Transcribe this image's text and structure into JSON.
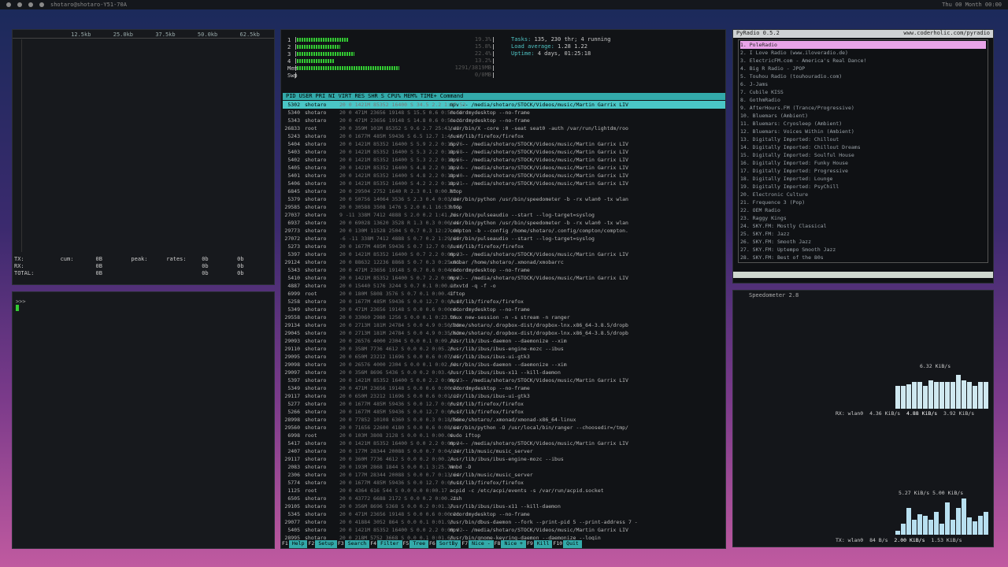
{
  "topbar": {
    "title": "shotaro@shotaro-Y51-70A",
    "tray": "Thu 00 Month 00:00"
  },
  "nload": {
    "scale": [
      "12.5kb",
      "25.0kb",
      "37.5kb",
      "50.0kb",
      "62.5kb"
    ],
    "stats_rows": [
      {
        "label": "TX:",
        "cols": [
          "cum:",
          "0B",
          "peak:",
          "rates:",
          "0b",
          "0b",
          "0b"
        ]
      },
      {
        "label": "RX:",
        "cols": [
          "",
          "0B",
          "",
          "",
          "0b",
          "0b",
          "0b"
        ]
      },
      {
        "label": "TOTAL:",
        "cols": [
          "",
          "0B",
          "",
          "",
          "0b",
          "0b",
          "0b"
        ]
      }
    ]
  },
  "term": {
    "prompt": ">>>"
  },
  "htop": {
    "cpus": [
      {
        "label": "1",
        "fill": 0.26,
        "pct": "19.3%"
      },
      {
        "label": "2",
        "fill": 0.22,
        "pct": "15.8%"
      },
      {
        "label": "3",
        "fill": 0.29,
        "pct": "22.4%"
      },
      {
        "label": "4",
        "fill": 0.19,
        "pct": "13.2%"
      },
      {
        "label": "Mem",
        "fill": 0.52,
        "pct": "1291/3819MB"
      },
      {
        "label": "Swp",
        "fill": 0.0,
        "pct": "0/0MB"
      }
    ],
    "info": [
      {
        "k": "Tasks:",
        "v": "135, 230 thr; 4 running"
      },
      {
        "k": "Load average:",
        "v": "1.28 1.22"
      },
      {
        "k": "Uptime:",
        "v": "4 days, 01:25:18"
      }
    ],
    "header": [
      "PID",
      "USER",
      "PRI",
      "NI",
      "VIRT",
      "RES",
      "SHR",
      "S",
      "CPU%",
      "MEM%",
      "TIME+",
      "Command"
    ],
    "rows": [
      {
        "pid": "5302",
        "user": "shotaro",
        "nums": "20 0 1421M 85352 16400 S 34.5 2.2 1:27.52",
        "cmd": "mpv -- /media/shotaro/STOCK/Videos/music/Martin Garrix LIV"
      },
      {
        "pid": "5340",
        "user": "shotaro",
        "nums": "20 0 471M 23656 19148 S 15.5 0.6 0:58.58",
        "cmd": "recordmydesktop --no-frame"
      },
      {
        "pid": "5343",
        "user": "shotaro",
        "nums": "20 0 471M 23656 19148 S 14.8 0.6 0:51.21",
        "cmd": "recordmydesktop --no-frame"
      },
      {
        "pid": "26833",
        "user": "root",
        "nums": "20 0 359M 101M 85352 S 9.6 2.7 25:43.43",
        "cmd": "/usr/bin/X -core :0 -seat seat0 -auth /var/run/lightdm/roo"
      },
      {
        "pid": "5243",
        "user": "shotaro",
        "nums": "20 0 1677M 485M 59436 S 6.5 12.7 1:46.40",
        "cmd": "/usr/lib/firefox/firefox"
      },
      {
        "pid": "5404",
        "user": "shotaro",
        "nums": "20 0 1421M 85352 16400 S 5.9 2.2 0:15.76",
        "cmd": "mpv -- /media/shotaro/STOCK/Videos/music/Martin Garrix LIV"
      },
      {
        "pid": "5403",
        "user": "shotaro",
        "nums": "20 0 1421M 85352 16400 S 5.3 2.2 0:12.58",
        "cmd": "mpv -- /media/shotaro/STOCK/Videos/music/Martin Garrix LIV"
      },
      {
        "pid": "5402",
        "user": "shotaro",
        "nums": "20 0 1421M 85352 16400 S 5.3 2.2 0:12.56",
        "cmd": "mpv -- /media/shotaro/STOCK/Videos/music/Martin Garrix LIV"
      },
      {
        "pid": "5405",
        "user": "shotaro",
        "nums": "20 0 1421M 85352 16400 S 4.8 2.2 0:12.34",
        "cmd": "mpv -- /media/shotaro/STOCK/Videos/music/Martin Garrix LIV"
      },
      {
        "pid": "5401",
        "user": "shotaro",
        "nums": "20 0 1421M 85352 16400 S 4.8 2.2 0:12.40",
        "cmd": "mpv -- /media/shotaro/STOCK/Videos/music/Martin Garrix LIV"
      },
      {
        "pid": "5406",
        "user": "shotaro",
        "nums": "20 0 1421M 85352 16400 S 4.2 2.2 0:12.31",
        "cmd": "mpv -- /media/shotaro/STOCK/Videos/music/Martin Garrix LIV"
      },
      {
        "pid": "6845",
        "user": "shotaro",
        "nums": "20 0 29504 2752 1640 R 2.3 0.1 0:00.83",
        "cmd": "htop"
      },
      {
        "pid": "5379",
        "user": "shotaro",
        "nums": "20 0 50756 14064 3536 S 2.3 0.4 0:03.84",
        "cmd": "/usr/bin/python /usr/bin/speedometer -b -rx wlan0 -tx wlan"
      },
      {
        "pid": "29585",
        "user": "shotaro",
        "nums": "20 0 30588 3508 1476 S 2.0 0.1 16:53.95",
        "cmd": "htop"
      },
      {
        "pid": "27037",
        "user": "shotaro",
        "nums": "9 -11 338M 7412 4888 S 2.0 0.2 1:41.26",
        "cmd": "/usr/bin/pulseaudio --start --log-target=syslog"
      },
      {
        "pid": "6937",
        "user": "shotaro",
        "nums": "20 0 69028 13620 3528 R 1.3 0.3 0:00.46",
        "cmd": "/usr/bin/python /usr/bin/speedometer -b -rx wlan0 -tx wlan"
      },
      {
        "pid": "29773",
        "user": "shotaro",
        "nums": "20 0 130M 11528 2504 S 0.7 0.3 12:27.07",
        "cmd": "compton -b --config /home/shotaro/.config/compton/compton."
      },
      {
        "pid": "27072",
        "user": "shotaro",
        "nums": "-6 -11 338M 7412 4888 S 0.7 0.2 1:29.69",
        "cmd": "/usr/bin/pulseaudio --start --log-target=syslog"
      },
      {
        "pid": "5273",
        "user": "shotaro",
        "nums": "20 0 1677M 485M 59436 S 0.7 12.7 0:01.46",
        "cmd": "/usr/lib/firefox/firefox"
      },
      {
        "pid": "5397",
        "user": "shotaro",
        "nums": "20 0 1421M 85352 16400 S 0.7 2.2 0:00.33",
        "cmd": "mpv -- /media/shotaro/STOCK/Videos/music/Martin Garrix LIV"
      },
      {
        "pid": "29124",
        "user": "shotaro",
        "nums": "20 0 88632 12236 8868 S 0.7 0.3 0:25.81",
        "cmd": "xmobar /home/shotaro/.xmonad/xmobarrc"
      },
      {
        "pid": "5343",
        "user": "shotaro",
        "nums": "20 0 471M 23656 19148 S 0.7 0.6 0:04.50",
        "cmd": "recordmydesktop --no-frame"
      },
      {
        "pid": "5410",
        "user": "shotaro",
        "nums": "20 0 1421M 85352 16400 S 0.7 2.2 0:00.02",
        "cmd": "mpv -- /media/shotaro/STOCK/Videos/music/Martin Garrix LIV"
      },
      {
        "pid": "4887",
        "user": "shotaro",
        "nums": "20 0 15440 5176 3244 S 0.7 0.1 0:00.13",
        "cmd": "urxvtd -q -f -o"
      },
      {
        "pid": "6999",
        "user": "root",
        "nums": "20 0 180M 5808 3576 S 0.7 0.1 0:00.41",
        "cmd": "iftop"
      },
      {
        "pid": "5258",
        "user": "shotaro",
        "nums": "20 0 1677M 485M 59436 S 0.0 12.7 0:03.83",
        "cmd": "/usr/lib/firefox/firefox"
      },
      {
        "pid": "5349",
        "user": "shotaro",
        "nums": "20 0 471M 23656 19148 S 0.0 0.6 0:00.01",
        "cmd": "recordmydesktop --no-frame"
      },
      {
        "pid": "29558",
        "user": "shotaro",
        "nums": "20 0 33060 2980 1256 S 0.0 0.1 0:23.95",
        "cmd": "tmux new-session -n -s stream -n ranger"
      },
      {
        "pid": "29134",
        "user": "shotaro",
        "nums": "20 0 2713M 181M 24784 S 0.0 4.9 0:50.28",
        "cmd": "/home/shotaro/.dropbox-dist/dropbox-lnx.x86_64-3.8.5/dropb"
      },
      {
        "pid": "29045",
        "user": "shotaro",
        "nums": "20 0 2713M 181M 24784 S 0.0 4.9 0:35.62",
        "cmd": "/home/shotaro/.dropbox-dist/dropbox-lnx.x86_64-3.8.5/dropb"
      },
      {
        "pid": "29093",
        "user": "shotaro",
        "nums": "20 0 26576 4000 2304 S 0.0 0.1 0:09.22",
        "cmd": "/usr/lib/ibus-daemon --daemonize --xim"
      },
      {
        "pid": "29110",
        "user": "shotaro",
        "nums": "20 0 358M 7736 4612 S 0.0 0.2 0:05.20",
        "cmd": "/usr/lib/ibus/ibus-engine-mozc --ibus"
      },
      {
        "pid": "29095",
        "user": "shotaro",
        "nums": "20 0 650M 23212 11696 S 0.0 0.6 0:07.45",
        "cmd": "/usr/lib/ibus/ibus-ui-gtk3"
      },
      {
        "pid": "29098",
        "user": "shotaro",
        "nums": "20 0 26576 4000 2304 S 0.0 0.1 0:02.60",
        "cmd": "/usr/bin/ibus-daemon --daemonize --xim"
      },
      {
        "pid": "29097",
        "user": "shotaro",
        "nums": "20 0 356M 8696 5436 S 0.0 0.2 0:03.42",
        "cmd": "/usr/lib/ibus/ibus-x11 --kill-daemon"
      },
      {
        "pid": "5397",
        "user": "shotaro",
        "nums": "20 0 1421M 85352 16400 S 0.0 2.2 0:00.23",
        "cmd": "mpv -- /media/shotaro/STOCK/Videos/music/Martin Garrix LIV"
      },
      {
        "pid": "5349",
        "user": "shotaro",
        "nums": "20 0 471M 23656 19148 S 0.0 0.6 0:00.70",
        "cmd": "recordmydesktop --no-frame"
      },
      {
        "pid": "29117",
        "user": "shotaro",
        "nums": "20 0 650M 23212 11696 S 0.0 0.6 0:01.17",
        "cmd": "/usr/lib/ibus/ibus-ui-gtk3"
      },
      {
        "pid": "5277",
        "user": "shotaro",
        "nums": "20 0 1677M 485M 59436 S 0.0 12.7 0:00.28",
        "cmd": "/usr/lib/firefox/firefox"
      },
      {
        "pid": "5266",
        "user": "shotaro",
        "nums": "20 0 1677M 485M 59436 S 0.0 12.7 0:00.17",
        "cmd": "/usr/lib/firefox/firefox"
      },
      {
        "pid": "28998",
        "user": "shotaro",
        "nums": "20 0 77852 10108 6360 S 0.0 0.3 0:18.56",
        "cmd": "/home/shotaro/.xmonad/xmonad-x86_64-linux"
      },
      {
        "pid": "29560",
        "user": "shotaro",
        "nums": "20 0 71656 22600 4180 S 0.0 0.6 0:08.64",
        "cmd": "/usr/bin/python -O /usr/local/bin/ranger --choosedir=/tmp/"
      },
      {
        "pid": "6998",
        "user": "root",
        "nums": "20 0 103M 3808 2128 S 0.0 0.1 0:00.00",
        "cmd": "sudo iftop"
      },
      {
        "pid": "5417",
        "user": "shotaro",
        "nums": "20 0 1421M 85352 16400 S 0.0 2.2 0:00.34",
        "cmd": "mpv -- /media/shotaro/STOCK/Videos/music/Martin Garrix LIV"
      },
      {
        "pid": "2407",
        "user": "shotaro",
        "nums": "20 0 177M 28344 20088 S 0.0 0.7 0:04.24",
        "cmd": "/usr/lib/music/music_server"
      },
      {
        "pid": "29117",
        "user": "shotaro",
        "nums": "20 0 360M 7736 4612 S 0.0 0.2 0:00.24",
        "cmd": "/usr/lib/ibus/ibus-engine-mozc --ibus"
      },
      {
        "pid": "2083",
        "user": "shotaro",
        "nums": "20 0 193M 2868 1844 S 0.0 0.1 3:25.74",
        "cmd": "mmbd -D"
      },
      {
        "pid": "2306",
        "user": "shotaro",
        "nums": "20 0 177M 28344 20088 S 0.0 0.7 0:13.64",
        "cmd": "/usr/lib/music/music_server"
      },
      {
        "pid": "5774",
        "user": "shotaro",
        "nums": "20 0 1677M 485M 59436 S 0.0 12.7 0:00.11",
        "cmd": "/usr/lib/firefox/firefox"
      },
      {
        "pid": "1125",
        "user": "root",
        "nums": "20 0 4364 616 544 S 0.0 0.0 0:00.17",
        "cmd": "acpid -c /etc/acpi/events -s /var/run/acpid.socket"
      },
      {
        "pid": "6505",
        "user": "shotaro",
        "nums": "20 0 43772 6688 2172 S 0.0 0.2 0:00.21",
        "cmd": "-zsh"
      },
      {
        "pid": "29105",
        "user": "shotaro",
        "nums": "20 0 356M 8696 5368 S 0.0 0.2 0:01.37",
        "cmd": "/usr/lib/ibus/ibus-x11 --kill-daemon"
      },
      {
        "pid": "5345",
        "user": "shotaro",
        "nums": "20 0 471M 23656 19148 S 0.0 0.6 0:00.28",
        "cmd": "recordmydesktop --no-frame"
      },
      {
        "pid": "29077",
        "user": "shotaro",
        "nums": "20 0 41884 3052 864 S 0.0 0.1 0:01.93",
        "cmd": "/usr/bin/dbus-daemon --fork --print-pid 5 --print-address 7 -"
      },
      {
        "pid": "5405",
        "user": "shotaro",
        "nums": "20 0 1421M 85352 16400 S 0.0 2.2 0:00.02",
        "cmd": "mpv -- /media/shotaro/STOCK/Videos/music/Martin Garrix LIV"
      },
      {
        "pid": "28995",
        "user": "shotaro",
        "nums": "20 0 218M 5752 3668 S 0.0 0.1 0:01.68",
        "cmd": "/usr/bin/gnome-keyring-daemon --daemonize --login"
      }
    ],
    "fkeys": [
      {
        "k": "F1",
        "v": "Help"
      },
      {
        "k": "F2",
        "v": "Setup"
      },
      {
        "k": "F3",
        "v": "Search"
      },
      {
        "k": "F4",
        "v": "Filter"
      },
      {
        "k": "F5",
        "v": "Tree"
      },
      {
        "k": "F6",
        "v": "SortBy"
      },
      {
        "k": "F7",
        "v": "Nice -"
      },
      {
        "k": "F8",
        "v": "Nice +"
      },
      {
        "k": "F9",
        "v": "Kill"
      },
      {
        "k": "F10",
        "v": "Quit"
      }
    ]
  },
  "pyradio": {
    "title": "PyRadio 0.5.2",
    "url": "www.coderholic.com/pyradio",
    "stations": [
      "1. PoleRadio",
      "2. I Love Radio (www.iloveradio.de)",
      "3. ElectricFM.com - America's Real Dance!",
      "4. Big R Radio - JPOP",
      "5. Touhou Radio (touhouradio.com)",
      "6. J-Jams",
      "7. Cubile KISS",
      "8. GothmRadio",
      "9. AfterHours.FM (Trance/Progressive)",
      "10. Bluemars (Ambient)",
      "11. Bluemars: Cryosleep (Ambient)",
      "12. Bluemars: Voices Within (Ambient)",
      "13. Digitally Imported: Chillout",
      "14. Digitally Imported: Chillout Dreams",
      "15. Digitally Imported: Soulful House",
      "16. Digitally Imported: Funky House",
      "17. Digitally Imported: Progressive",
      "18. Digitally Imported: Lounge",
      "19. Digitally Imported: PsyChill",
      "20. Electronic Culture",
      "21. Frequence 3 (Pop)",
      "22. OEM Radio",
      "23. Raggy Kings",
      "24. SKY.FM: Mostly Classical",
      "25. SKY.FM: Jazz",
      "26. SKY.FM: Smooth Jazz",
      "27. SKY.FM: Uptempo Smooth Jazz",
      "28. SKY.FM: Best of the 80s"
    ]
  },
  "speedometer": {
    "title": "Speedometer 2.8",
    "rx_peak": "6.32 KiB/s",
    "rx_line": [
      "RX: wlan0",
      "4.36 KiB/s",
      "4.88 KiB/s",
      "3.92 KiB/s"
    ],
    "tx_peak": "5.27 KiB/s",
    "tx_peak2": "5.00 KiB/s",
    "tx_line": [
      "TX: wlan0",
      "84 B/s",
      "2.00 KiB/s",
      "1.53 KiB/s"
    ],
    "rx_bars": [
      0.6,
      0.6,
      0.65,
      0.7,
      0.7,
      0.6,
      0.75,
      0.7,
      0.7,
      0.7,
      0.7,
      0.9,
      0.75,
      0.7,
      0.6,
      0.7,
      0.7
    ],
    "tx_bars": [
      0.1,
      0.3,
      0.7,
      0.4,
      0.55,
      0.5,
      0.4,
      0.6,
      0.3,
      0.85,
      0.4,
      0.7,
      0.95,
      0.45,
      0.35,
      0.5,
      0.6
    ]
  }
}
